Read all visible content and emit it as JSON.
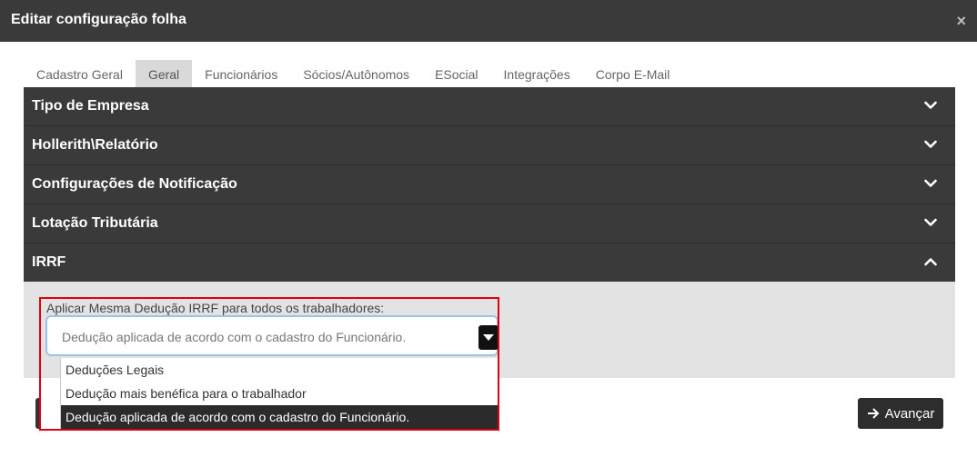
{
  "window": {
    "title": "Editar configuração folha",
    "close_glyph": "×"
  },
  "tabs": [
    {
      "label": "Cadastro Geral"
    },
    {
      "label": "Geral",
      "active": true
    },
    {
      "label": "Funcionários"
    },
    {
      "label": "Sócios/Autônomos"
    },
    {
      "label": "ESocial"
    },
    {
      "label": "Integrações"
    },
    {
      "label": "Corpo E-Mail"
    }
  ],
  "sections": [
    {
      "label": "Tipo de Empresa",
      "expanded": false
    },
    {
      "label": "Hollerith\\Relatório",
      "expanded": false
    },
    {
      "label": "Configurações de Notificação",
      "expanded": false
    },
    {
      "label": "Lotação Tributária",
      "expanded": false
    },
    {
      "label": "IRRF",
      "expanded": true
    }
  ],
  "irrf": {
    "field_label": "Aplicar Mesma Dedução IRRF para todos os trabalhadores:",
    "selected_value": "Dedução aplicada de acordo com o cadastro do Funcionário.",
    "options": [
      "Deduções Legais",
      "Dedução mais benéfica para o trabalhador",
      "Dedução aplicada de acordo com o cadastro do Funcionário."
    ],
    "selected_index": 2
  },
  "footer": {
    "advance_label": "Avançar",
    "advance_icon": "arrow-right-icon"
  },
  "colors": {
    "header_bg": "#3a3a3a",
    "body_bg": "#e3e3e3",
    "highlight": "#e1000f",
    "select_border": "#9ec1e8"
  }
}
